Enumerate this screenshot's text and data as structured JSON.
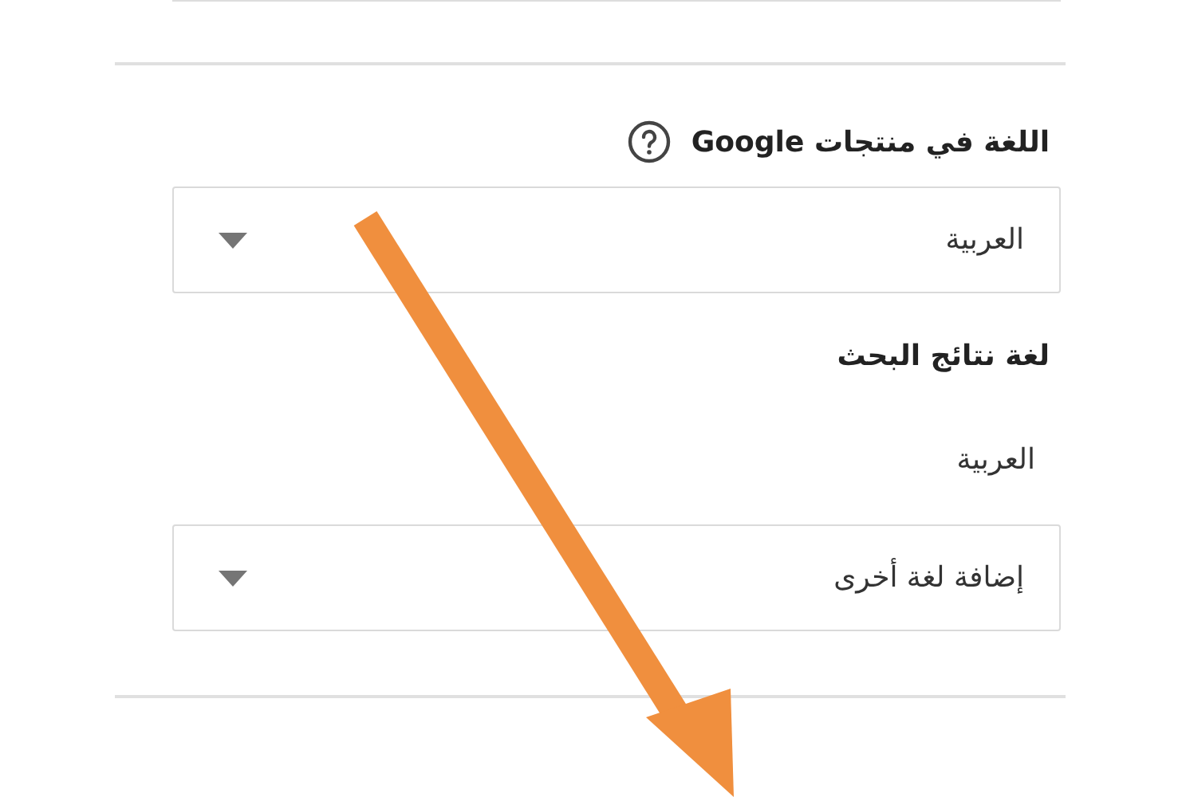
{
  "product_language": {
    "title": "اللغة في منتجات **Google**",
    "select": {
      "value": "العربية"
    }
  },
  "search_language": {
    "title": "لغة نتائج البحث",
    "current": "العربية",
    "select": {
      "value": "إضافة لغة أخرى"
    }
  }
}
